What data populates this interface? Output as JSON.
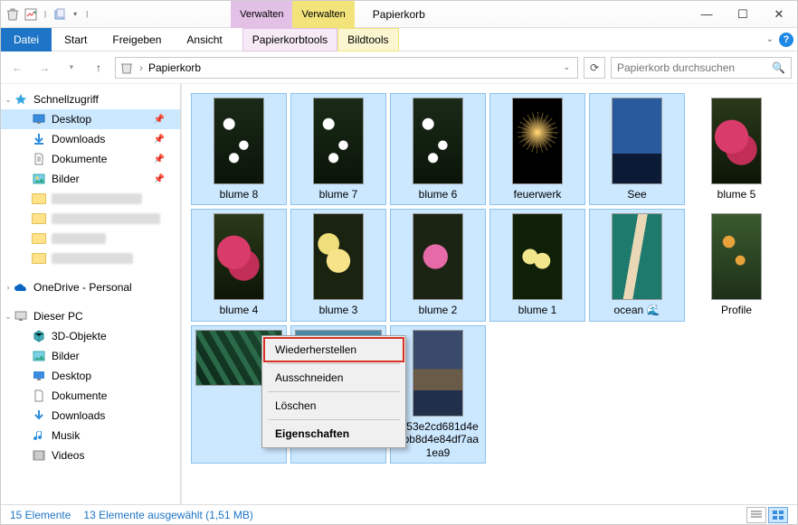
{
  "window": {
    "title": "Papierkorb"
  },
  "qat": {
    "dropdown": true
  },
  "ctxtabs": {
    "manage1": "Verwalten",
    "manage2": "Verwalten",
    "sub1": "Papierkorbtools",
    "sub2": "Bildtools"
  },
  "ribbon": {
    "file": "Datei",
    "start": "Start",
    "share": "Freigeben",
    "view": "Ansicht"
  },
  "address": {
    "location": "Papierkorb",
    "search_placeholder": "Papierkorb durchsuchen"
  },
  "sidebar": {
    "quick": "Schnellzugriff",
    "desktop": "Desktop",
    "downloads": "Downloads",
    "documents": "Dokumente",
    "pictures": "Bilder",
    "onedrive": "OneDrive - Personal",
    "thispc": "Dieser PC",
    "pc_3d": "3D-Objekte",
    "pc_pictures": "Bilder",
    "pc_desktop": "Desktop",
    "pc_documents": "Dokumente",
    "pc_downloads": "Downloads",
    "pc_music": "Musik",
    "pc_videos": "Videos"
  },
  "items": {
    "r1": [
      "blume 8",
      "blume 7",
      "blume 6",
      "feuerwerk",
      "See",
      "blume 5"
    ],
    "r2": [
      "blume 4",
      "blume 3",
      "blume 2",
      "blume 1",
      "ocean 🌊",
      "Profile"
    ],
    "r3_long": "7f53e2cd681d4e7bb8d4e84df7aa1ea9"
  },
  "ctxmenu": {
    "restore": "Wiederherstellen",
    "cut": "Ausschneiden",
    "delete": "Löschen",
    "properties": "Eigenschaften"
  },
  "status": {
    "count": "15 Elemente",
    "selection": "13 Elemente ausgewählt (1,51 MB)"
  }
}
